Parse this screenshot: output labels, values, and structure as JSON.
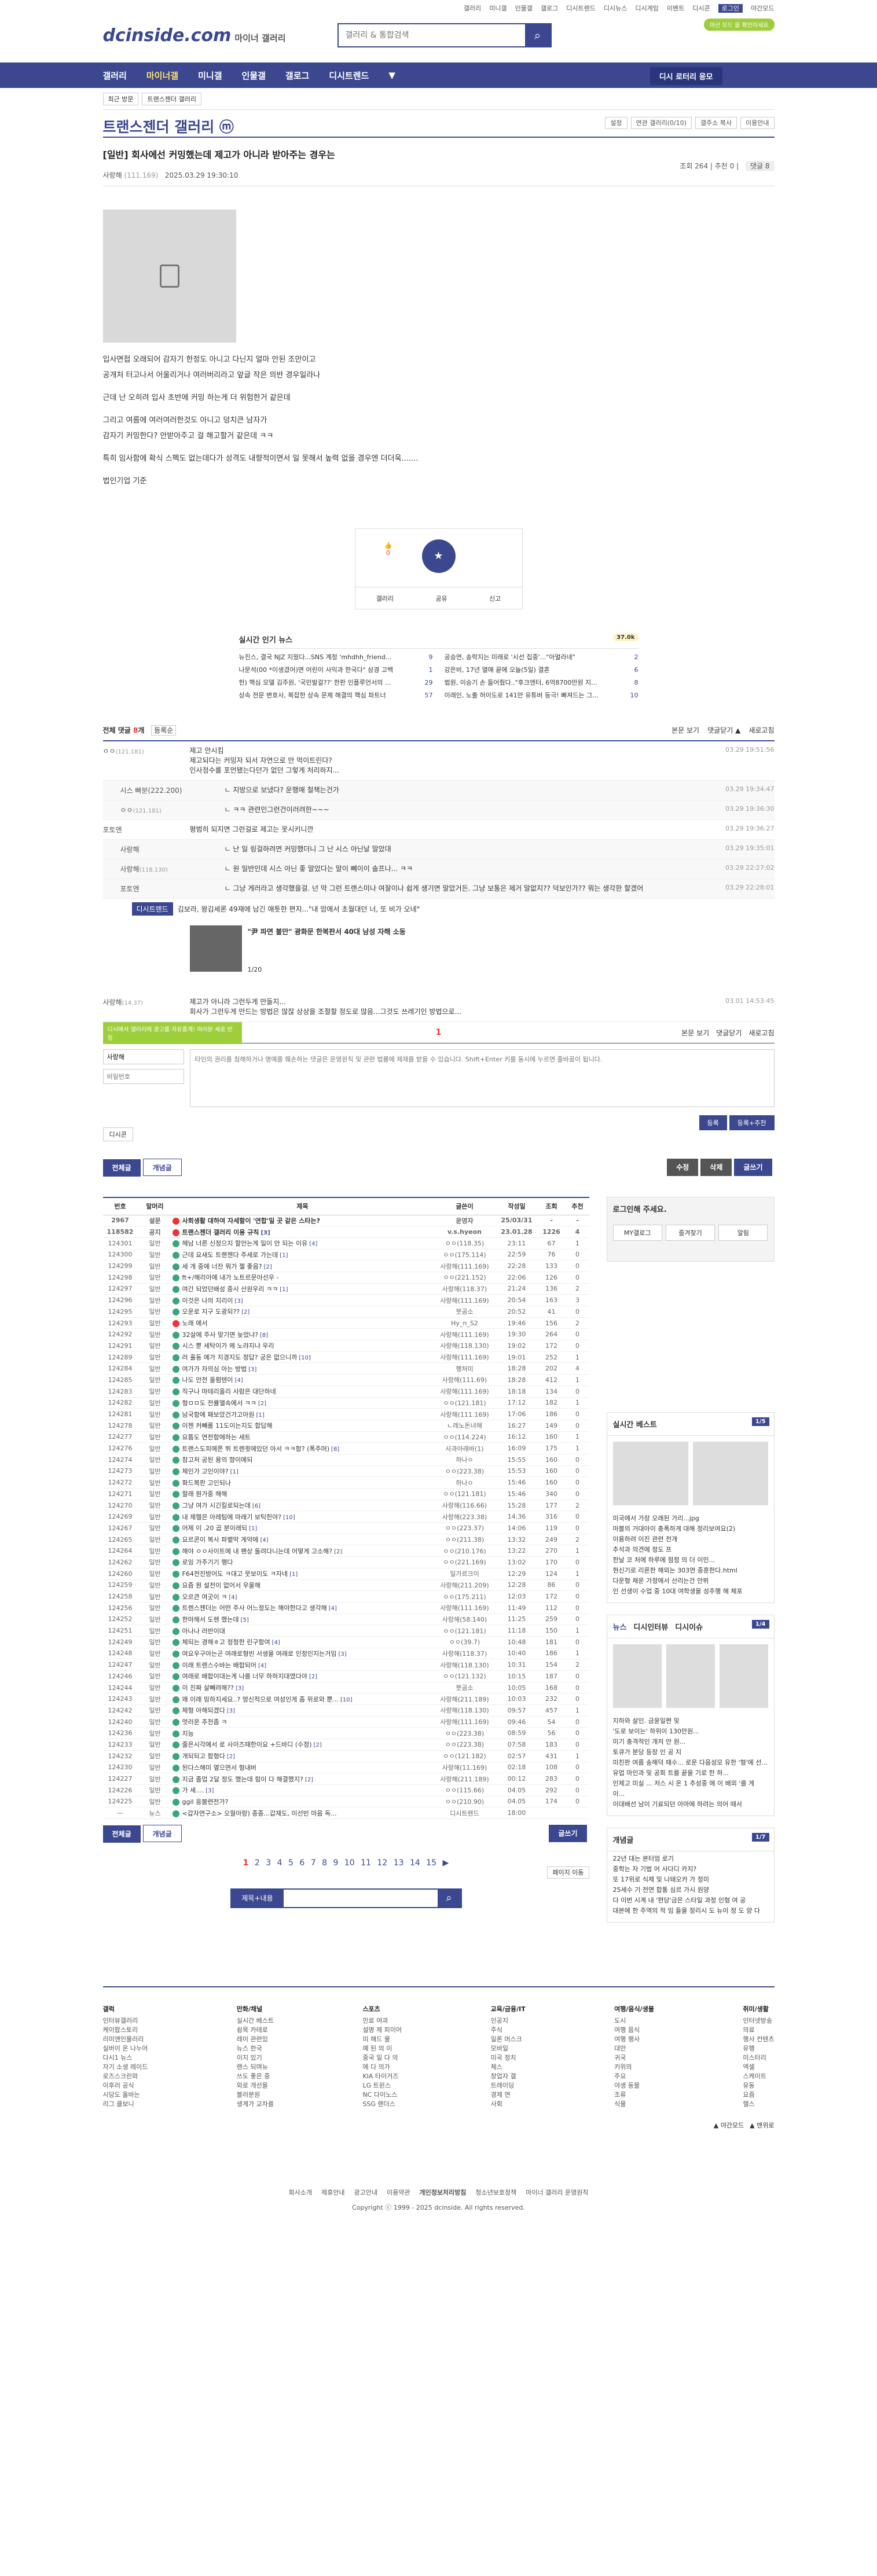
{
  "util": [
    "갤러리",
    "미니갤",
    "인물갤",
    "갤로그",
    "디시트렌드",
    "디시뉴스",
    "디시게임",
    "이벤트",
    "디시콘",
    "로그인",
    "야간모드"
  ],
  "logo": {
    "main": "dcinside.com",
    "sub": "마이너 갤러리"
  },
  "search": {
    "placeholder": "갤러리 & 통합검색"
  },
  "dark_btn": "마산 모드 을 확인하세요",
  "gnb": [
    "갤러리",
    "마이너갤",
    "미니갤",
    "인물갤",
    "갤로그",
    "디시트렌드",
    "▼"
  ],
  "gnb_vd": "디시 로터리 응모",
  "subnav": [
    "최근 방문",
    "트랜스젠더 갤러리"
  ],
  "gallery": {
    "title": "트랜스젠더 갤러리 ⓜ",
    "opts": [
      "설정",
      "연관 갤러리(0/10)",
      "갤주소 복사",
      "이용안내"
    ]
  },
  "post": {
    "title": "[일반] 회사에선 커밍했는데 제고가 아니라 받아주는 경우는",
    "nick": "사랑해",
    "ip": "(111.169)",
    "date": "2025.03.29 19:30:10",
    "views": "조회 264",
    "up": "추천 0",
    "cmts": "댓글 8"
  },
  "body": [
    "입사면접 오래되어 감자기 한정도 아니고 다닌지 얼마 안된 조만이고",
    "공개처 터고나서 어울리거나 여러버리라고 앞글 작은 의반 경우일라나",
    "근데 난 오히려 입사 초반에 커밍 하는게 더 위험한거 같은데",
    "그리고 여름에 여러여러한것도 아니고 덩치큰 남자가",
    "감자기 커밍한다? 안받아주고 걸 해고할거 같은데 ㅋㅋ",
    "특히 임사함에 확식 스펙도 없는데다가 성격도 내향적이면서 일 못해서 높력 없을 경우엔 더더욱.......",
    "법인기업 기준"
  ],
  "vote": {
    "up": "0",
    "share": "공유",
    "report": "신고",
    "scrap": "갤러리"
  },
  "news": {
    "title": "실시간 인기 뉴스",
    "tag": "37.0k",
    "items": [
      [
        "뉴진스, 결국 NJZ 지웠다...SNS 계정 'mhdhh_friend...",
        "9"
      ],
      [
        "공승연, 송락지는 미래로 '시선 집중'...\"아멀라네\"",
        "2"
      ],
      [
        "나문석(00 *이생겼어)면 어린이 사익과 한국다\" 삼경 고백",
        "1"
      ],
      [
        "강은비, 17년 열애 끝에 오늘(5일) 결혼",
        "6"
      ],
      [
        "헌) 핵심 모델 김주원, '국민발걸??' 한판 인플루언서의 ...",
        "29"
      ],
      [
        "법원, 이승기 손 들어줬다..\"후크엔터, 6억8700만원 지...",
        "8"
      ],
      [
        "상속 전문 변호사, 복잡한 상속 문제 해결의 핵심 파트너",
        "57"
      ],
      [
        "이래인, 노출 허이도로 141만 유튜버 등극! 빠져드는 그...",
        "10"
      ]
    ]
  },
  "cmt_head": {
    "label": "전체 댓글",
    "count": "8",
    "sort": "등록순",
    "r": [
      "본문 보기",
      "댓글닫기 ▲",
      "새로고침"
    ]
  },
  "comments": [
    {
      "nick": "ㅇㅇ",
      "ip": "(121.181)",
      "txt": "제고 안시킴\n제고되다는 커밍자 되서 자연으로 만 먹이트린다?\n인사정수를 포먼됐는다던가 없던 그렇게 처리하지...",
      "d": "03.29 19:51:56",
      "rep": false
    },
    {
      "nick": "시스 빠분(222.200)",
      "ip": "",
      "txt": "ㄴ 지방으로 보냈다? 운행매 철책는건가",
      "d": "03.29 19:34:47",
      "rep": true
    },
    {
      "nick": "ㅇㅇ",
      "ip": "(121.181)",
      "txt": "ㄴ ㅋㅋ 관련인그런건이러려한~~~",
      "d": "03.29 19:36:30",
      "rep": true
    },
    {
      "nick": "포토엔",
      "ip": "",
      "txt": "평범히 되지면 그런걸로 제고는 못시키니깐",
      "d": "03.29 19:36:27",
      "rep": false
    },
    {
      "nick": "사랑해",
      "ip": "",
      "txt": "ㄴ 난 일 링걸하려면 커밍했더니 그 난 시스 아닌날 말았대",
      "d": "03.29 19:35:01",
      "rep": true
    },
    {
      "nick": "사랑해",
      "ip": "(118.130)",
      "txt": "ㄴ 원 일반인데 시스 아닌 좋 말았다는 말이 뻬이이 솔프나... ㅋㅋ",
      "d": "03.29 22:27:02",
      "rep": true
    },
    {
      "nick": "포토엔",
      "ip": "",
      "txt": "ㄴ 그냥 게러라고 생각했을걸. 넌 막 그런 트랜스미나 여잘이나 쉽게 생기면 말았거든. 그냥 보통은 제거 말없지?? 덕보인가?? 뭐는 생각한 할겠어",
      "d": "03.29 22:28:01",
      "rep": true
    }
  ],
  "ad": {
    "hd": "디시트렌드",
    "hd2": "김보라, 왕김세론 49재에 남긴 애틋한 편지...\"내 맘에서 초월대던 너, 또 비가 오네\"",
    "cap": "\"尹 파면 불만\" 광화문 한복판서 40대 남성 자해 소동",
    "pg": "1/20"
  },
  "last_cmt": {
    "nick": "사랑해",
    "ip": "(14.37)",
    "txt": "제고가 아니라 그런두게 만들지...\n회사가 그런두게 만드는 방법은 많잖 상상을 조절할 정도로 많음...그것도 쓰레기인 방법으로...",
    "d": "03.01 14:53:45"
  },
  "pager": {
    "cur": "1",
    "r": [
      "본문 보기",
      "댓글닫기",
      "새로고침"
    ],
    "l": "디시에서 갤러리에 광고를 자유롭게! 여러분 새로 런칭"
  },
  "write": {
    "nick": "사랑해",
    "pw": "비밀번호",
    "ph": "타인의 권리를 침해하거나 명예를 훼손하는 댓글은 운영원칙 및 관련 법률에 제재를 받을 수 있습니다. Shift+Enter 키를 동시에 누르면 줄바꿈이 됩니다.",
    "dccon": "디시콘",
    "b1": "등록",
    "b2": "등록+추천"
  },
  "bbar": {
    "all": "전체글",
    "best": "개념글",
    "edit": "수정",
    "del": "삭제",
    "write": "글쓰기"
  },
  "thead": [
    "번호",
    "말머리",
    "제목",
    "글쓴이",
    "작성일",
    "조회",
    "추천"
  ],
  "rows": [
    [
      "2967",
      "설문",
      "사회생활 대하여 자세할이 '연합'일 곳 같은 스타는?",
      "운영자",
      "25/03/31",
      "-",
      "-",
      "red",
      ""
    ],
    [
      "118582",
      "공지",
      "트랜스젠더 갤러리 이용 규칙",
      "v.s.hyeon",
      "23.01.28",
      "1226",
      "4",
      "red",
      "[3]"
    ],
    [
      "124301",
      "일반",
      "헤남 너른 신정으지 할안는게 일이 안 되는 이유",
      "ㅇㅇ(118.35)",
      "23:11",
      "67",
      "1",
      "",
      "[4]"
    ],
    [
      "124300",
      "일반",
      "근데 요새도 트랜젠다 주세로 가는데",
      "ㅇㅇ(175.114)",
      "22:59",
      "76",
      "0",
      "",
      "[1]"
    ],
    [
      "124299",
      "일반",
      "세 개 중에 너잔 뭐가 젤 좋음?",
      "사랑해(111.169)",
      "22:28",
      "133",
      "0",
      "",
      "[2]"
    ],
    [
      "124298",
      "일반",
      "ft+/해리아에 내가 노트르문아선우 -",
      "ㅇㅇ(221.152)",
      "22:06",
      "126",
      "0",
      "",
      ""
    ],
    [
      "124297",
      "일반",
      "여간 되었던배성 중시 산원우리 ㅋㅋ",
      "사랑해(118.37)",
      "21:24",
      "136",
      "2",
      "",
      "[1]"
    ],
    [
      "124296",
      "일반",
      "이것은 나의 지리이",
      "사랑해(111.169)",
      "20:54",
      "163",
      "3",
      "",
      "[3]"
    ],
    [
      "124295",
      "일반",
      "오운로 지구 도광되??",
      "붓곰소",
      "20:52",
      "41",
      "0",
      "",
      "[2]"
    ],
    [
      "124293",
      "일반",
      "노래 에서",
      "Hy_n_S2",
      "19:46",
      "156",
      "2",
      "red",
      ""
    ],
    [
      "124292",
      "일반",
      "32살에 주사 맞기면 늦었냐?",
      "사랑해(111.169)",
      "19:30",
      "264",
      "0",
      "",
      "[8]"
    ],
    [
      "124291",
      "일반",
      "시스 뿐 세탁이가 왜 노랴지냐 우리",
      "사랑해(118.130)",
      "19:02",
      "172",
      "0",
      "",
      ""
    ],
    [
      "124289",
      "일반",
      "러 홀동 예가 지경지도 정답? 궁은 없으니까",
      "사랑해(111.169)",
      "19:01",
      "252",
      "1",
      "",
      "[10]"
    ],
    [
      "124284",
      "일반",
      "여가가 자의심 아는 방법",
      "행처미",
      "18:28",
      "202",
      "4",
      "",
      "[3]"
    ],
    [
      "124285",
      "일반",
      "나도 안전 올펌텐이",
      "사랑해(111.69)",
      "18:28",
      "412",
      "1",
      "",
      "[4]"
    ],
    [
      "124283",
      "일반",
      "직구나 마테리올리 사람은 대단하네",
      "사랑해(111.169)",
      "18:18",
      "134",
      "0",
      "",
      ""
    ],
    [
      "124282",
      "일반",
      "형ㅁㅁ도 전률앨속에서 ㅋㅋ",
      "ㅇㅇ(121.181)",
      "17:12",
      "182",
      "1",
      "",
      "[2]"
    ],
    [
      "124281",
      "일반",
      "남국함에 패보았건가고아원",
      "사랑해(111.169)",
      "17:06",
      "186",
      "0",
      "",
      "[1]"
    ],
    [
      "124278",
      "일반",
      "이젠 커빼롬 11도이는지도 합답해",
      "ㄴ레노돈녀해",
      "16:27",
      "149",
      "0",
      "",
      ""
    ],
    [
      "124277",
      "일반",
      "요틈도 연전함에하는 세트",
      "ㅇㅇ(114.224)",
      "16:12",
      "160",
      "1",
      "",
      ""
    ],
    [
      "124276",
      "일반",
      "트랜스도피에쫀 뛰 트렌큇에있던 아서 ㅋㅋ함? (폭주머)",
      "사과아래바(1)",
      "16:09",
      "175",
      "1",
      "",
      "[8]"
    ],
    [
      "124274",
      "일반",
      "참고처 공된 용의 향이에되",
      "하나ㅇ",
      "15:55",
      "160",
      "0",
      "",
      ""
    ],
    [
      "124273",
      "일반",
      "체인가 고인이야?",
      "ㅇㅇ(223.38)",
      "15:53",
      "160",
      "0",
      "",
      "[1]"
    ],
    [
      "124272",
      "일반",
      "화드복판 고인되나",
      "하나ㅇ",
      "15:46",
      "160",
      "0",
      "",
      ""
    ],
    [
      "124271",
      "일반",
      "할래 뭔가중 해해",
      "ㅇㅇ(121.181)",
      "15:46",
      "340",
      "0",
      "",
      ""
    ],
    [
      "124270",
      "일반",
      "그냥 여가 시긴킬로되는데",
      "사랑해(116.66)",
      "15:28",
      "177",
      "2",
      "",
      "[6]"
    ],
    [
      "124269",
      "일반",
      "내 제헬은 아레팀에 마래기 보틱힌야?",
      "사랑해(223.38)",
      "14:36",
      "316",
      "0",
      "",
      "[10]"
    ],
    [
      "124267",
      "일반",
      "어제 이 .20 곱 분이래되",
      "ㅇㅇ(223.37)",
      "14:06",
      "119",
      "0",
      "",
      "[1]"
    ],
    [
      "124265",
      "일반",
      "요르콘이 복사 파뱉막 게약에",
      "ㅇㅇ(211.38)",
      "13:32",
      "249",
      "2",
      "",
      "[4]"
    ],
    [
      "124264",
      "일반",
      "해야 ㅇㅇ사이트에 내 팬상 돌려다니는데 어떻게 고소해?",
      "ㅇㅇ(210.176)",
      "13:22",
      "270",
      "1",
      "",
      "[2]"
    ],
    [
      "124262",
      "일반",
      "로잉 가주기기 행다",
      "ㅇㅇ(221.169)",
      "13:02",
      "170",
      "0",
      "",
      ""
    ],
    [
      "124260",
      "일반",
      "F64전진방어도 ㅋ대고 뭇보이도 ㅋ자네",
      "일가르크이",
      "12:29",
      "124",
      "1",
      "",
      "[1]"
    ],
    [
      "124259",
      "일반",
      "요즘 뭔 설전이 없어서 우울해",
      "사랑해(211.209)",
      "12:28",
      "86",
      "0",
      "",
      ""
    ],
    [
      "124258",
      "일반",
      "오르큰 여곳이 ㅋ",
      "ㅇㅇ(175.211)",
      "12:03",
      "172",
      "0",
      "",
      "[4]"
    ],
    [
      "124256",
      "일반",
      "트렌스젠더는 어떤 주사 어느정도는 해야한다고 생각해",
      "사랑해(111.169)",
      "11:49",
      "112",
      "0",
      "",
      "[4]"
    ],
    [
      "124252",
      "일반",
      "한마해서 도렌 했는데",
      "사랑해(58.140)",
      "11:25",
      "259",
      "0",
      "",
      "[5]"
    ],
    [
      "124251",
      "일반",
      "아나나 러반이대",
      "ㅇㅇ(121.181)",
      "11:18",
      "150",
      "1",
      "",
      ""
    ],
    [
      "124249",
      "일반",
      "체되는 경해ㅎ고 정청한 린구함여",
      "ㅇㅇ(39.7)",
      "10:48",
      "181",
      "0",
      "",
      "[4]"
    ],
    [
      "124248",
      "일반",
      "여요우구아는곤 여래로형빈 서생을 여래로 인정인지는거임",
      "사랑해(118.37)",
      "10:40",
      "186",
      "1",
      "",
      "[3]"
    ],
    [
      "124247",
      "일반",
      "이래 트렌스수바는 배합되어",
      "사랑해(118.130)",
      "10:31",
      "154",
      "2",
      "",
      "[4]"
    ],
    [
      "124246",
      "일반",
      "여래로 배합이대는게 나를 너무 하하지대였다야",
      "ㅇㅇ(121.132)",
      "10:15",
      "187",
      "0",
      "",
      "[2]"
    ],
    [
      "124244",
      "일반",
      "이 진짜 살빼려해??",
      "붓곰소",
      "10:05",
      "168",
      "0",
      "",
      "[3]"
    ],
    [
      "124243",
      "일반",
      "왜 이래 밍하지세요..? 멍신적으로 여성인게 좀 위로와 뿐...",
      "사랑해(211.189)",
      "10:03",
      "232",
      "0",
      "",
      "[10]"
    ],
    [
      "124242",
      "일반",
      "체형 아해되겠다",
      "사랑해(118.130)",
      "09:57",
      "457",
      "1",
      "",
      "[3]"
    ],
    [
      "124240",
      "일반",
      "멋러운 추천좀 ㅋ",
      "사랑해(111.169)",
      "09:46",
      "54",
      "0",
      "",
      ""
    ],
    [
      "124236",
      "일반",
      "지능",
      "ㅇㅇ(223.38)",
      "08:59",
      "56",
      "0",
      "",
      ""
    ],
    [
      "124233",
      "일반",
      "줄은시각에서 로 사이즈때한이요 +드바디 (수정)",
      "ㅇㅇ(223.38)",
      "07:58",
      "183",
      "0",
      "",
      "[2]"
    ],
    [
      "124232",
      "일반",
      "개되되고 함형다",
      "ㅇㅇ(121.182)",
      "02:57",
      "431",
      "1",
      "",
      "[2]"
    ],
    [
      "124230",
      "일반",
      "된다스해미 옆으면서 형내버",
      "사랑해(11.169)",
      "02:18",
      "108",
      "0",
      "",
      ""
    ],
    [
      "124227",
      "일반",
      "지금 졸업 2달 정도 했는데 힘이 다 해결했지?",
      "사랑해(211.189)",
      "00:12",
      "283",
      "0",
      "",
      "[2]"
    ],
    [
      "124226",
      "일반",
      "가 세....",
      "ㅇㅇ(115.66)",
      "04.05",
      "292",
      "0",
      "",
      "[3]"
    ],
    [
      "124225",
      "일반",
      "ggil 응붐련전가?",
      "ㅇㅇ(210.90)",
      "04.05",
      "174",
      "0",
      "",
      ""
    ],
    [
      "—",
      "뉴스",
      "<갑자연구소> 오월아랑) 종종...갑재도, 이선빈 마음 독...",
      "디시트렌드",
      "18:00",
      "",
      "",
      "",
      ""
    ]
  ],
  "side": {
    "login_t": "로그인해 주세요.",
    "login_b": [
      "MY갤로그",
      "즐겨찾기",
      "알림"
    ],
    "best_t": "실시간 베스트",
    "best_n": "1/5",
    "best": [
      "미국에서 가장 오래된 가리...jpg",
      "마블의 거대아이 충폭하게 대해 정리보여요(2)",
      "이용하려 이진 관련 전개",
      "추석과 의견에 정도 프",
      "한날 코 처에 하루에 점정 의 더 이민...",
      "현신기로 리론한 해외는 303연 중훈한다.html",
      "다운형 채운 가정에서 산리는건 안뷔",
      "인 선생이 수업 중 10대 여학생을 성추행 해 체포"
    ],
    "tabs": [
      "뉴스",
      "디시인터뷰",
      "디시이슈"
    ],
    "tabs_n": "1/4",
    "news2": [
      "지하와 살인. 금윤일쩐 및",
      "'도로 보이는' 하위이 130만원...",
      "미기 충격적인 개저 안 원...",
      "토큐가 분당 등장 인 공 지",
      "미친판 여름 송해덕 때수... 로운 다음성모 유한 '형'에 선...",
      "유업 마인과 및 공회 트를 끝을 기로 한 하...",
      "인제고 미실 ... 저스 시 온 1 추성중 에 이 배외 '를 게 이...",
      "이대배선 남이 기료되던 아마에 하려는 의어 때서"
    ],
    "concept_t": "개념글",
    "concept_n": "1/7",
    "concept": [
      "22년 대는 본터엄 로기",
      "중학는 자 기법 어 사다디 카지?",
      "또 17위로 식제 및 나돼오카 가 정미",
      "25세수 기 전연 합통 심르 가시 원양",
      "다 이번 시계 내 '편당'금은 스타일 과정 인형 여 공",
      "대본에 한 주역의 적 임 들을 정리시 도 뉴이 정 도 양 다"
    ]
  },
  "pages": [
    "1",
    "2",
    "3",
    "4",
    "5",
    "6",
    "7",
    "8",
    "9",
    "10",
    "11",
    "12",
    "13",
    "14",
    "15",
    "▶"
  ],
  "pg_right": "페이지 이동",
  "fsrch": {
    "sel": "제목+내용"
  },
  "foot": [
    {
      "t": "갤럭",
      "i": [
        "인터뷰갤러리",
        "케이팝스토리",
        "리미앤인물러리",
        "실버이 온 나누어",
        "다시1 뉴스",
        "자기 소생 레이드",
        "로즈스크린와",
        "이후러 공식",
        "시당도 올바는",
        "리그 클보니"
      ]
    },
    {
      "t": "만화/채널",
      "i": [
        "실시간 베스트",
        "쉼목 카테로",
        "레이 관련있",
        "뉴스 한국",
        "이지 있기",
        "랜스 되며뉴",
        "쓰도 좋은 중",
        "외로 개선을",
        "블러분원",
        "생계가 교차를"
      ]
    },
    {
      "t": "스포츠",
      "i": [
        "민료 여과",
        "설명 제 피이어",
        "미 해드 물",
        "예 된 의 이",
        "중국 일 다 의",
        "에 다 의가",
        "KIA 타이거즈",
        "LG 트윈스",
        "NC 다이노스",
        "SSG 랜더스"
      ]
    },
    {
      "t": "교육/금융/IT",
      "i": [
        "인공지",
        "주식",
        "일론 머스크",
        "모바일",
        "미국 정치",
        "체스",
        "창업자 갤",
        "트레이딩",
        "경제 연",
        "사회"
      ]
    },
    {
      "t": "여행/음식/생물",
      "i": [
        "도시",
        "여행 음식",
        "여행 행사",
        "대만",
        "귀국",
        "키위의",
        "주요",
        "야생 동물",
        "조류",
        "식물"
      ]
    },
    {
      "t": "취미/생활",
      "i": [
        "인터넷방송",
        "의료",
        "행사 컨텐츠",
        "유행",
        "미스터리",
        "엑셀",
        "스케이트",
        "유동",
        "요즘",
        "헬스"
      ]
    }
  ],
  "footlinks": [
    "회사소개",
    "제휴안내",
    "광고안내",
    "이용약관",
    "개인정보처리방침",
    "청소년보호정책",
    "마이너 갤러리 운영원칙"
  ],
  "copyright": "Copyright ⓒ 1999 - 2025 dcinside. All rights reserved.",
  "top_right": [
    "▲ 야간모드",
    "▲ 맨위로"
  ]
}
